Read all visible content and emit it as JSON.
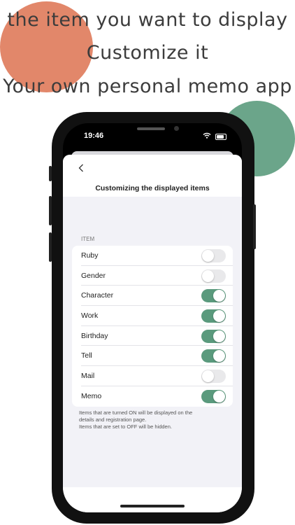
{
  "promo": {
    "line1": "the item you want to display",
    "line2": "Customize it",
    "line3": "Your own personal memo app"
  },
  "status_bar": {
    "time": "19:46",
    "wifi_icon": "wifi-icon",
    "battery_icon": "battery-icon"
  },
  "nav": {
    "back_icon": "chevron-left-icon",
    "title": "Customizing the displayed items"
  },
  "section_header": "ITEM",
  "items": [
    {
      "label": "Ruby",
      "on": false
    },
    {
      "label": "Gender",
      "on": false
    },
    {
      "label": "Character",
      "on": true
    },
    {
      "label": "Work",
      "on": true
    },
    {
      "label": "Birthday",
      "on": true
    },
    {
      "label": "Tell",
      "on": true
    },
    {
      "label": "Mail",
      "on": false
    },
    {
      "label": "Memo",
      "on": true
    }
  ],
  "footer": {
    "line1": "Items that are turned ON will be displayed on the",
    "line2": "details and registration page.",
    "line3": "Items that are set to OFF will be hidden."
  },
  "colors": {
    "accent": "#5a9a7d",
    "blob_orange": "#e2876a",
    "blob_green": "#6ba58a"
  }
}
